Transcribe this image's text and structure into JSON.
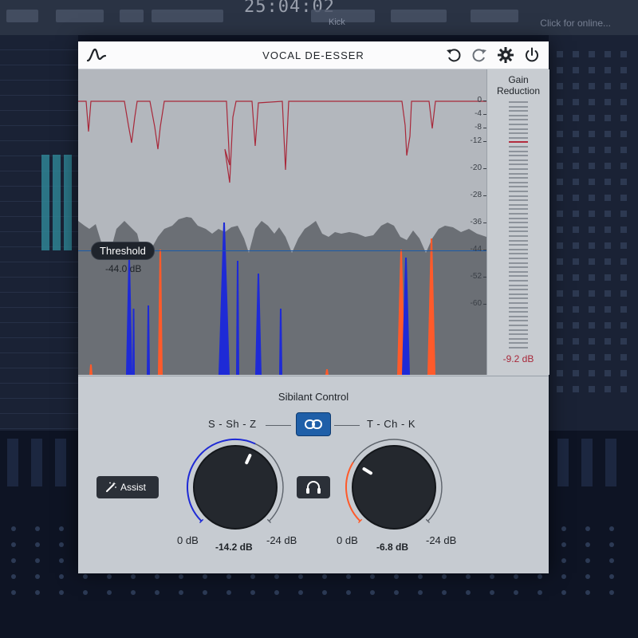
{
  "daw": {
    "clock": "25:04:02",
    "track": "Kick",
    "hint": "Click for online..."
  },
  "plugin": {
    "title": "VOCAL DE-ESSER",
    "icons": [
      "waveform-logo-icon",
      "undo-icon",
      "redo-icon",
      "gear-icon",
      "power-icon"
    ]
  },
  "display": {
    "scale_labels": [
      "0",
      "-4",
      "-8",
      "-12",
      "-20",
      "-28",
      "-36",
      "-44",
      "-52",
      "-60"
    ],
    "threshold": {
      "label": "Threshold",
      "value": "-44.0 dB",
      "db": -44.0
    }
  },
  "gain_reduction": {
    "label_line1": "Gain",
    "label_line2": "Reduction",
    "value": "-9.2 dB",
    "db": -9.2
  },
  "controls": {
    "title": "Sibilant Control",
    "left_group": "S - Sh - Z",
    "right_group": "T - Ch - K",
    "link_active": true,
    "assist_label": "Assist",
    "left_knob": {
      "min": "0 dB",
      "max": "-24 dB",
      "value": "-14.2 dB",
      "db": -14.2,
      "accent": "#1e2ad6"
    },
    "right_knob": {
      "min": "0 dB",
      "max": "-24 dB",
      "value": "-6.8 dB",
      "db": -6.8,
      "accent": "#ff5a2a"
    }
  },
  "colors": {
    "gain_reduction_trace": "#a8283a",
    "spectrum": "#6b6f75",
    "sibilant_s": "#1e2ad6",
    "sibilant_t": "#ff5a2a",
    "threshold_line": "#1b5aa8",
    "link_active": "#1f5fa8"
  }
}
